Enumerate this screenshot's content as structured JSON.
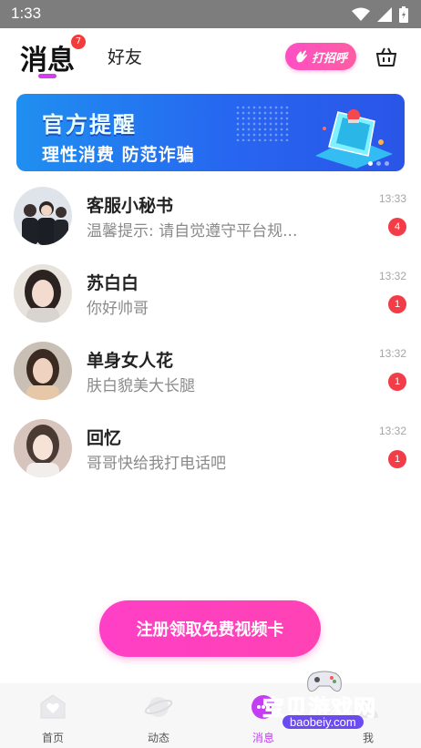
{
  "status_bar": {
    "time": "1:33"
  },
  "header": {
    "tab_messages": "消息",
    "messages_badge": "7",
    "tab_friends": "好友",
    "greet_button": "打招呼"
  },
  "banner": {
    "title": "官方提醒",
    "subtitle": "理性消费 防范诈骗"
  },
  "conversations": [
    {
      "name": "客服小秘书",
      "preview": "温馨提示: 请自觉遵守平台规...",
      "time": "13:33",
      "unread": "4"
    },
    {
      "name": "苏白白",
      "preview": "你好帅哥",
      "time": "13:32",
      "unread": "1"
    },
    {
      "name": "单身女人花",
      "preview": "肤白貌美大长腿",
      "time": "13:32",
      "unread": "1"
    },
    {
      "name": "回忆",
      "preview": "哥哥快给我打电话吧",
      "time": "13:32",
      "unread": "1"
    }
  ],
  "register_button": "注册领取免费视频卡",
  "bottom_nav": [
    {
      "label": "首页"
    },
    {
      "label": "动态"
    },
    {
      "label": "消息"
    },
    {
      "label": "我"
    }
  ],
  "watermark": {
    "text": "宝贝游戏网",
    "url": "baobeiy.com"
  },
  "colors": {
    "accent": "#d43cf0",
    "badge": "#f23c48",
    "button": "#ff3fc6",
    "banner": "#2766f0"
  }
}
